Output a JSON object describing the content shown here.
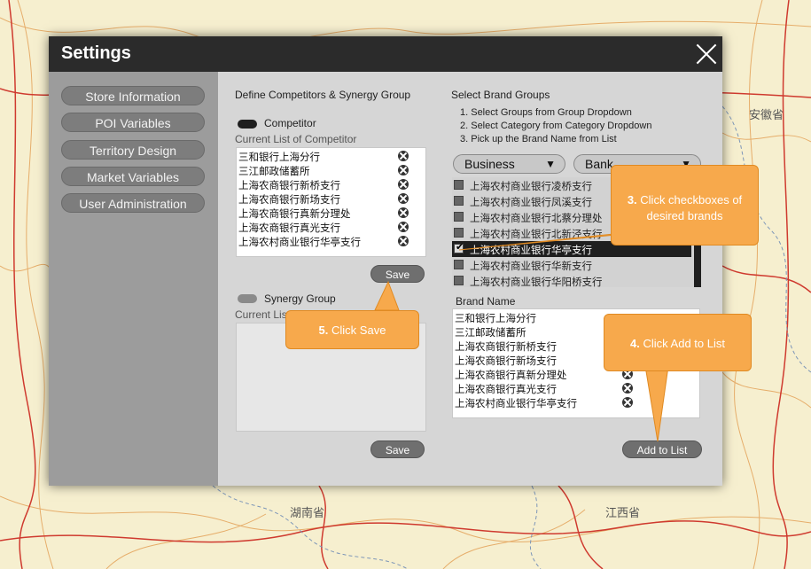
{
  "map": {
    "labels": [
      "安徽省",
      "湖南省",
      "江西省"
    ]
  },
  "dialog": {
    "title": "Settings",
    "sidebar": [
      "Store Information",
      "POI Variables",
      "Territory Design",
      "Market Variables",
      "User Administration"
    ]
  },
  "competitors": {
    "heading": "Define Competitors & Synergy Group",
    "toggle_label": "Competitor",
    "list_label": "Current List of Competitor",
    "items": [
      "三和银行上海分行",
      "三江邮政储蓄所",
      "上海农商银行新桥支行",
      "上海农商银行新场支行",
      "上海农商银行真新分理处",
      "上海农商银行真光支行",
      "上海农村商业银行华亭支行"
    ],
    "save": "Save"
  },
  "synergy": {
    "toggle_label": "Synergy Group",
    "list_label": "Current List of Synergy Group",
    "save": "Save"
  },
  "brand_groups": {
    "heading": "Select Brand Groups",
    "steps": [
      "1. Select Groups from Group Dropdown",
      "2. Select Category from Category Dropdown",
      "3. Pick up the Brand Name from List"
    ],
    "group_dropdown": "Business",
    "category_dropdown": "Bank",
    "checkbox_items": [
      "上海农村商业银行凌桥支行",
      "上海农村商业银行凤溪支行",
      "上海农村商业银行北蔡分理处",
      "上海农村商业银行北新泾支行",
      "上海农村商业银行华亭支行",
      "上海农村商业银行华新支行",
      "上海农村商业银行华阳桥支行"
    ],
    "brand_label": "Brand Name",
    "brand_items": [
      "三和银行上海分行",
      "三江邮政储蓄所",
      "上海农商银行新桥支行",
      "上海农商银行新场支行",
      "上海农商银行真新分理处",
      "上海农商银行真光支行",
      "上海农村商业银行华亭支行"
    ],
    "add": "Add to List"
  },
  "callouts": {
    "c3_num": "3.",
    "c3_text": "Click checkboxes of desired brands",
    "c4_num": "4.",
    "c4_text": "Click Add to List",
    "c5_num": "5.",
    "c5_text": "Click Save"
  }
}
